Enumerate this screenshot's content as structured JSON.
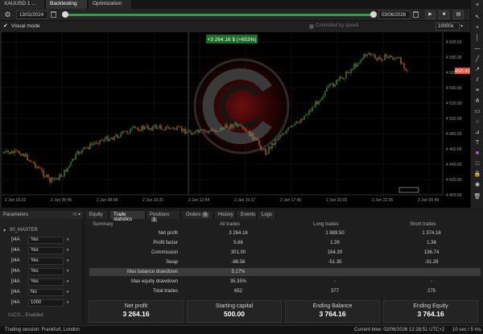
{
  "tabs": [
    {
      "label": "XAUUSD 1 ..."
    },
    {
      "label": "Backtesting"
    },
    {
      "label": "Optimization"
    }
  ],
  "timebar": {
    "start_date": "13/02/2024",
    "end_date": "03/06/2026",
    "progress": 1.0
  },
  "options": {
    "visual_mode_label": "Visual mode",
    "visual_mode_checked": true,
    "speed_text": "Controlled by speed",
    "speed_value": "10000x"
  },
  "chart": {
    "pnl_label": "+3 264.16 $ (+653%)",
    "price_tag": "4525.00",
    "price_axis": [
      "4 600.00",
      "4 580.00",
      "4 560.00",
      "4 540.00",
      "4 520.00",
      "4 500.00",
      "4 480.00",
      "4 460.00",
      "4 440.00",
      "4 420.00",
      "4 400.00"
    ],
    "time_axis": [
      "2 Jun 03:22",
      "2 Jun 05:45",
      "2 Jun 08:08",
      "2 Jun 10:31",
      "2 Jun 12:54",
      "2 Jun 15:17",
      "2 Jun 17:40",
      "2 Jun 20:03",
      "2 Jun 22:26",
      "3 Jun 00:49"
    ],
    "marker_time": "2 Jun 00:49",
    "colors": {
      "bull": "#3e9a5a",
      "bear": "#d9613a",
      "price_tag": "#e0503a",
      "pnl": "#3a8f3a"
    }
  },
  "parameters": {
    "header": "Parameters",
    "section": "00_MASTER",
    "rows": [
      {
        "key": "[I4A",
        "value": "Yes"
      },
      {
        "key": "[I4A",
        "value": "Yes"
      },
      {
        "key": "[I4A",
        "value": "Yes"
      },
      {
        "key": "[I4A",
        "value": "Yes"
      },
      {
        "key": "[I4A",
        "value": "Yes"
      },
      {
        "key": "[I4A",
        "value": "No"
      },
      {
        "key": "[I4A",
        "value": "1000"
      }
    ],
    "footer": "01CS... Enabled"
  },
  "stats": {
    "tabs": [
      {
        "label": "Equity",
        "badge": ""
      },
      {
        "label": "Trade statistics",
        "badge": ""
      },
      {
        "label": "Positions",
        "badge": "1"
      },
      {
        "label": "Orders",
        "badge": "0"
      },
      {
        "label": "History",
        "badge": ""
      },
      {
        "label": "Events",
        "badge": ""
      },
      {
        "label": "Logs",
        "badge": ""
      }
    ],
    "columns": [
      "Summary",
      "All trades",
      "Long trades",
      "Short trades"
    ],
    "rows": [
      {
        "label": "Net profit",
        "all": "3 264.16",
        "long": "1 889.50",
        "short": "1 374.16"
      },
      {
        "label": "Profit factor",
        "all": "5.66",
        "long": "1.39",
        "short": "1.36"
      },
      {
        "label": "Commission",
        "all": "301.00",
        "long": "164.30",
        "short": "136.74"
      },
      {
        "label": "Swap",
        "all": "-86.56",
        "long": "-51.35",
        "short": "-31.29"
      },
      {
        "label": "Max balance drawdown",
        "all": "5.17%",
        "long": "",
        "short": ""
      },
      {
        "label": "Max equity drawdown",
        "all": "35.35%",
        "long": "-",
        "short": "-"
      },
      {
        "label": "Total trades",
        "all": "652",
        "long": "377",
        "short": "275"
      }
    ],
    "summary": [
      {
        "label": "Net profit",
        "value": "3 264.16"
      },
      {
        "label": "Starting capital",
        "value": "500.00"
      },
      {
        "label": "Ending Balance",
        "value": "3 764.16"
      },
      {
        "label": "Ending Equity",
        "value": "3 764.16"
      }
    ]
  },
  "statusbar": {
    "left": "Trading session: Frankfurt, London",
    "right": "Current time: 02/06/2026 12:28:51 UTC+2",
    "far": "10 sec / 5 ms"
  }
}
